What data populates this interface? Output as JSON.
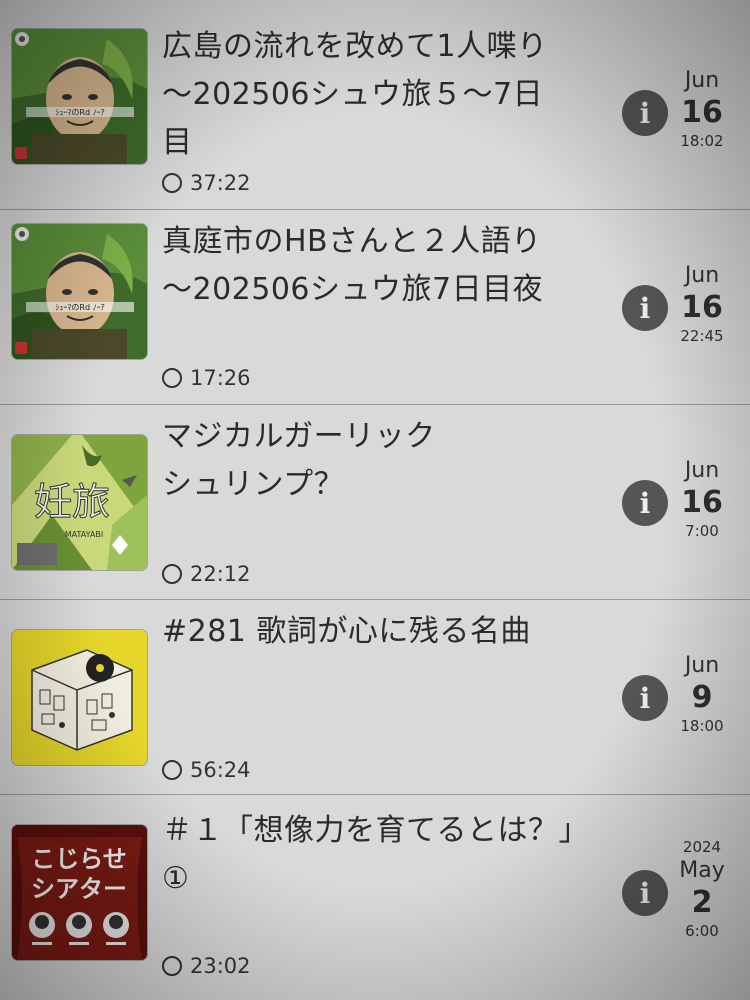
{
  "episodes": [
    {
      "title_line1": "広島の流れを改めて1人喋り",
      "title_line2": "～202506シュウ旅５～7日",
      "title_line3": "目",
      "duration": "37:22",
      "date": {
        "year": "",
        "month": "Jun",
        "day": "16",
        "time": "18:02"
      },
      "artwork": "portrait-podcast-art",
      "artwork_text": "ｼｭｰﾏのRd ﾉｰｱ",
      "info_icon": "info-icon"
    },
    {
      "title_line1": "真庭市のHBさんと２人語り",
      "title_line2": "～202506シュウ旅7日目夜",
      "title_line3": "",
      "duration": "17:26",
      "date": {
        "year": "",
        "month": "Jun",
        "day": "16",
        "time": "22:45"
      },
      "artwork": "portrait-podcast-art",
      "artwork_text": "ｼｭｰﾏのRd ﾉｰｱ",
      "info_icon": "info-icon"
    },
    {
      "title_line1": "マジカルガーリック",
      "title_line2": "シュリンプ？",
      "title_line3": "",
      "duration": "22:12",
      "date": {
        "year": "",
        "month": "Jun",
        "day": "16",
        "time": "7:00"
      },
      "artwork": "travel-podcast-art",
      "artwork_text": "妊旅",
      "artwork_subtext": "MATAYABI",
      "info_icon": "info-icon"
    },
    {
      "title_line1": "#281 歌詞が心に残る名曲",
      "title_line2": "",
      "title_line3": "",
      "duration": "56:24",
      "date": {
        "year": "",
        "month": "Jun",
        "day": "9",
        "time": "18:00"
      },
      "artwork": "record-store-podcast-art",
      "info_icon": "info-icon"
    },
    {
      "title_line1": "＃１「想像力を育てるとは？」",
      "title_line2": "①",
      "title_line3": "",
      "duration": "23:02",
      "date": {
        "year": "2024",
        "month": "May",
        "day": "2",
        "time": "6:00"
      },
      "artwork": "theater-podcast-art",
      "artwork_text_line1": "こじらせ",
      "artwork_text_line2": "シアター",
      "info_icon": "info-icon"
    }
  ],
  "colors": {
    "background": "#d9d9d9",
    "info_button": "#555555",
    "theater_red": "#7a1a14",
    "yellow_art": "#e6d62a"
  }
}
